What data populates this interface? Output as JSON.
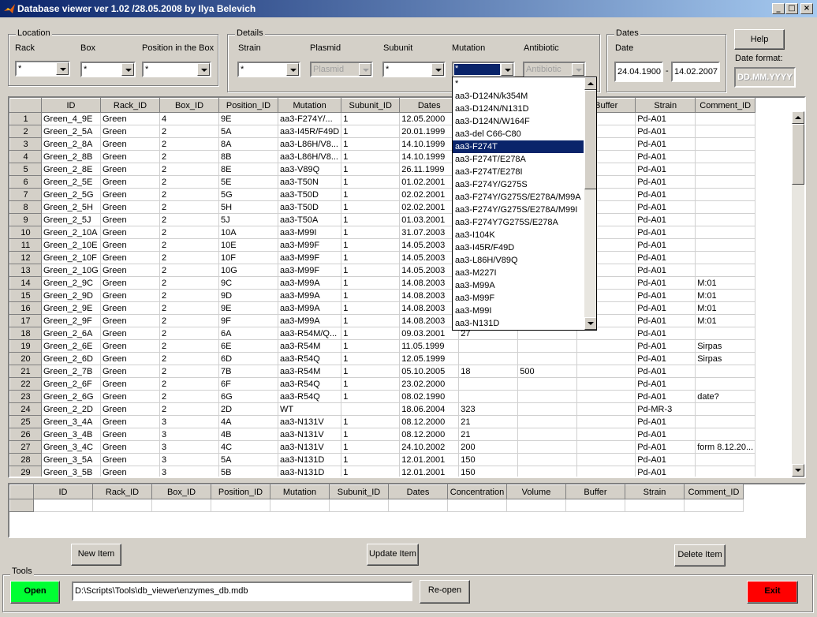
{
  "window": {
    "title": "Database viewer ver 1.02 /28.05.2008 by Ilya Belevich"
  },
  "location": {
    "title": "Location",
    "rack": {
      "label": "Rack",
      "value": "*"
    },
    "box": {
      "label": "Box",
      "value": "*"
    },
    "position": {
      "label": "Position in the Box",
      "value": "*"
    }
  },
  "details": {
    "title": "Details",
    "strain": {
      "label": "Strain",
      "value": "*"
    },
    "plasmid": {
      "label": "Plasmid",
      "value": "Plasmid"
    },
    "subunit": {
      "label": "Subunit",
      "value": "*"
    },
    "mutation": {
      "label": "Mutation",
      "value": "*"
    },
    "antibiotic": {
      "label": "Antibiotic",
      "value": "Antibiotic"
    }
  },
  "dates": {
    "title": "Dates",
    "label": "Date",
    "from": "24.04.1900",
    "sep": "-",
    "to": "14.02.2007"
  },
  "help": {
    "label": "Help",
    "format_label": "Date format:",
    "format_value": "DD.MM.YYYY"
  },
  "mutation_options": [
    "*",
    "aa3-D124N/k354M",
    "aa3-D124N/N131D",
    "aa3-D124N/W164F",
    "aa3-del C66-C80",
    "aa3-F274T",
    "aa3-F274T/E278A",
    "aa3-F274T/E278I",
    "aa3-F274Y/G275S",
    "aa3-F274Y/G275S/E278A/M99A",
    "aa3-F274Y/G275S/E278A/M99I",
    "aa3-F274Y7G275S/E278A",
    "aa3-I104K",
    "aa3-I45R/F49D",
    "aa3-L86H/V89Q",
    "aa3-M227I",
    "aa3-M99A",
    "aa3-M99F",
    "aa3-M99I",
    "aa3-N131D"
  ],
  "main_table": {
    "columns": [
      "",
      "ID",
      "Rack_ID",
      "Box_ID",
      "Position_ID",
      "Mutation",
      "Subunit_ID",
      "Dates",
      "",
      "",
      "Buffer",
      "Strain",
      "Comment_ID"
    ],
    "rows": [
      [
        "1",
        "Green_4_9E",
        "Green",
        "4",
        "9E",
        "aa3-F274Y/...",
        "1",
        "12.05.2000",
        "",
        "",
        "",
        "Pd-A01",
        ""
      ],
      [
        "2",
        "Green_2_5A",
        "Green",
        "2",
        "5A",
        "aa3-I45R/F49D",
        "1",
        "20.01.1999",
        "",
        "",
        "",
        "Pd-A01",
        ""
      ],
      [
        "3",
        "Green_2_8A",
        "Green",
        "2",
        "8A",
        "aa3-L86H/V8...",
        "1",
        "14.10.1999",
        "",
        "",
        "",
        "Pd-A01",
        ""
      ],
      [
        "4",
        "Green_2_8B",
        "Green",
        "2",
        "8B",
        "aa3-L86H/V8...",
        "1",
        "14.10.1999",
        "",
        "",
        "",
        "Pd-A01",
        ""
      ],
      [
        "5",
        "Green_2_8E",
        "Green",
        "2",
        "8E",
        "aa3-V89Q",
        "1",
        "26.11.1999",
        "",
        "",
        "",
        "Pd-A01",
        ""
      ],
      [
        "6",
        "Green_2_5E",
        "Green",
        "2",
        "5E",
        "aa3-T50N",
        "1",
        "01.02.2001",
        "",
        "",
        "",
        "Pd-A01",
        ""
      ],
      [
        "7",
        "Green_2_5G",
        "Green",
        "2",
        "5G",
        "aa3-T50D",
        "1",
        "02.02.2001",
        "",
        "",
        "",
        "Pd-A01",
        ""
      ],
      [
        "8",
        "Green_2_5H",
        "Green",
        "2",
        "5H",
        "aa3-T50D",
        "1",
        "02.02.2001",
        "",
        "",
        "",
        "Pd-A01",
        ""
      ],
      [
        "9",
        "Green_2_5J",
        "Green",
        "2",
        "5J",
        "aa3-T50A",
        "1",
        "01.03.2001",
        "",
        "",
        "",
        "Pd-A01",
        ""
      ],
      [
        "10",
        "Green_2_10A",
        "Green",
        "2",
        "10A",
        "aa3-M99I",
        "1",
        "31.07.2003",
        "",
        "",
        "",
        "Pd-A01",
        ""
      ],
      [
        "11",
        "Green_2_10E",
        "Green",
        "2",
        "10E",
        "aa3-M99F",
        "1",
        "14.05.2003",
        "",
        "",
        "",
        "Pd-A01",
        ""
      ],
      [
        "12",
        "Green_2_10F",
        "Green",
        "2",
        "10F",
        "aa3-M99F",
        "1",
        "14.05.2003",
        "",
        "",
        "",
        "Pd-A01",
        ""
      ],
      [
        "13",
        "Green_2_10G",
        "Green",
        "2",
        "10G",
        "aa3-M99F",
        "1",
        "14.05.2003",
        "",
        "",
        "",
        "Pd-A01",
        ""
      ],
      [
        "14",
        "Green_2_9C",
        "Green",
        "2",
        "9C",
        "aa3-M99A",
        "1",
        "14.08.2003",
        "",
        "",
        "",
        "Pd-A01",
        "M:01"
      ],
      [
        "15",
        "Green_2_9D",
        "Green",
        "2",
        "9D",
        "aa3-M99A",
        "1",
        "14.08.2003",
        "",
        "",
        "",
        "Pd-A01",
        "M:01"
      ],
      [
        "16",
        "Green_2_9E",
        "Green",
        "2",
        "9E",
        "aa3-M99A",
        "1",
        "14.08.2003",
        "",
        "",
        "",
        "Pd-A01",
        "M:01"
      ],
      [
        "17",
        "Green_2_9F",
        "Green",
        "2",
        "9F",
        "aa3-M99A",
        "1",
        "14.08.2003",
        "",
        "",
        "",
        "Pd-A01",
        "M:01"
      ],
      [
        "18",
        "Green_2_6A",
        "Green",
        "2",
        "6A",
        "aa3-R54M/Q...",
        "1",
        "09.03.2001",
        "27",
        "",
        "",
        "Pd-A01",
        ""
      ],
      [
        "19",
        "Green_2_6E",
        "Green",
        "2",
        "6E",
        "aa3-R54M",
        "1",
        "11.05.1999",
        "",
        "",
        "",
        "Pd-A01",
        "Sirpas"
      ],
      [
        "20",
        "Green_2_6D",
        "Green",
        "2",
        "6D",
        "aa3-R54Q",
        "1",
        "12.05.1999",
        "",
        "",
        "",
        "Pd-A01",
        "Sirpas"
      ],
      [
        "21",
        "Green_2_7B",
        "Green",
        "2",
        "7B",
        "aa3-R54M",
        "1",
        "05.10.2005",
        "18",
        "500",
        "",
        "Pd-A01",
        ""
      ],
      [
        "22",
        "Green_2_6F",
        "Green",
        "2",
        "6F",
        "aa3-R54Q",
        "1",
        "23.02.2000",
        "",
        "",
        "",
        "Pd-A01",
        ""
      ],
      [
        "23",
        "Green_2_6G",
        "Green",
        "2",
        "6G",
        "aa3-R54Q",
        "1",
        "08.02.1990",
        "",
        "",
        "",
        "Pd-A01",
        "date?"
      ],
      [
        "24",
        "Green_2_2D",
        "Green",
        "2",
        "2D",
        "WT",
        "",
        "18.06.2004",
        "323",
        "",
        "",
        "Pd-MR-3",
        ""
      ],
      [
        "25",
        "Green_3_4A",
        "Green",
        "3",
        "4A",
        "aa3-N131V",
        "1",
        "08.12.2000",
        "21",
        "",
        "",
        "Pd-A01",
        ""
      ],
      [
        "26",
        "Green_3_4B",
        "Green",
        "3",
        "4B",
        "aa3-N131V",
        "1",
        "08.12.2000",
        "21",
        "",
        "",
        "Pd-A01",
        ""
      ],
      [
        "27",
        "Green_3_4C",
        "Green",
        "3",
        "4C",
        "aa3-N131V",
        "1",
        "24.10.2002",
        "200",
        "",
        "",
        "Pd-A01",
        "form 8.12.20..."
      ],
      [
        "28",
        "Green_3_5A",
        "Green",
        "3",
        "5A",
        "aa3-N131D",
        "1",
        "12.01.2001",
        "150",
        "",
        "",
        "Pd-A01",
        ""
      ],
      [
        "29",
        "Green_3_5B",
        "Green",
        "3",
        "5B",
        "aa3-N131D",
        "1",
        "12.01.2001",
        "150",
        "",
        "",
        "Pd-A01",
        ""
      ]
    ]
  },
  "edit_table": {
    "columns": [
      "",
      "ID",
      "Rack_ID",
      "Box_ID",
      "Position_ID",
      "Mutation",
      "Subunit_ID",
      "Dates",
      "Concentration",
      "Volume",
      "Buffer",
      "Strain",
      "Comment_ID"
    ]
  },
  "buttons": {
    "new": "New Item",
    "update": "Update Item",
    "delete": "Delete Item"
  },
  "tools": {
    "title": "Tools",
    "open": "Open",
    "path": "D:\\Scripts\\Tools\\db_viewer\\enzymes_db.mdb",
    "reopen": "Re-open",
    "exit": "Exit"
  },
  "colors": {
    "open": "#00ff33",
    "exit": "#ff0000",
    "title_bar": "#0a246a",
    "selection": "#0a246a"
  }
}
